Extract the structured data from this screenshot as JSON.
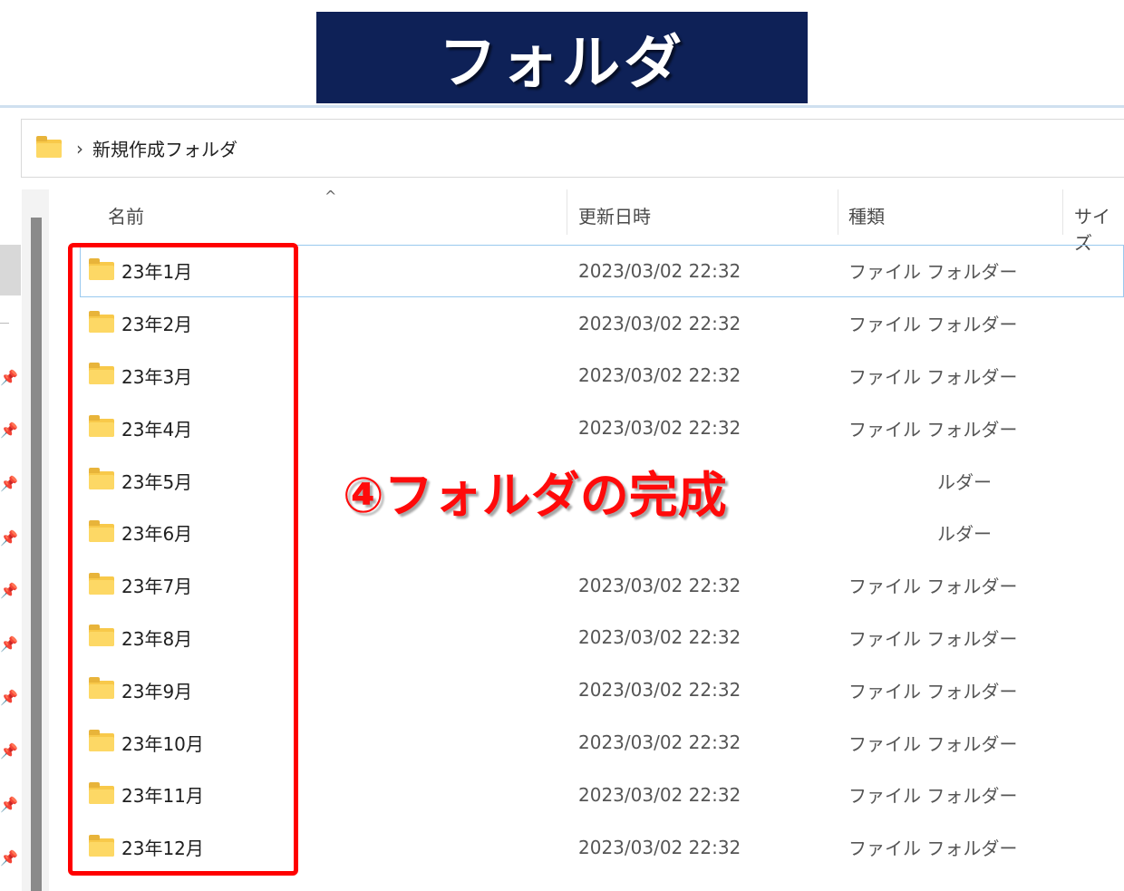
{
  "banner": {
    "title": "フォルダ"
  },
  "address_bar": {
    "chevron": "›",
    "breadcrumb": "新規作成フォルダ"
  },
  "columns": {
    "sort_indicator": "^",
    "name": "名前",
    "date": "更新日時",
    "type": "種類",
    "size": "サイズ"
  },
  "rows": [
    {
      "name": "23年1月",
      "date": "2023/03/02 22:32",
      "type": "ファイル フォルダー"
    },
    {
      "name": "23年2月",
      "date": "2023/03/02 22:32",
      "type": "ファイル フォルダー"
    },
    {
      "name": "23年3月",
      "date": "2023/03/02 22:32",
      "type": "ファイル フォルダー"
    },
    {
      "name": "23年4月",
      "date": "2023/03/02 22:32",
      "type": "ファイル フォルダー"
    },
    {
      "name": "23年5月",
      "date": "",
      "type": "ルダー"
    },
    {
      "name": "23年6月",
      "date": "",
      "type": "ルダー"
    },
    {
      "name": "23年7月",
      "date": "2023/03/02 22:32",
      "type": "ファイル フォルダー"
    },
    {
      "name": "23年8月",
      "date": "2023/03/02 22:32",
      "type": "ファイル フォルダー"
    },
    {
      "name": "23年9月",
      "date": "2023/03/02 22:32",
      "type": "ファイル フォルダー"
    },
    {
      "name": "23年10月",
      "date": "2023/03/02 22:32",
      "type": "ファイル フォルダー"
    },
    {
      "name": "23年11月",
      "date": "2023/03/02 22:32",
      "type": "ファイル フォルダー"
    },
    {
      "name": "23年12月",
      "date": "2023/03/02 22:32",
      "type": "ファイル フォルダー"
    }
  ],
  "annotation": {
    "text": "④フォルダの完成"
  },
  "colors": {
    "banner_bg": "#0e2157",
    "highlight": "#ff0000",
    "folder": "#fdd865"
  }
}
